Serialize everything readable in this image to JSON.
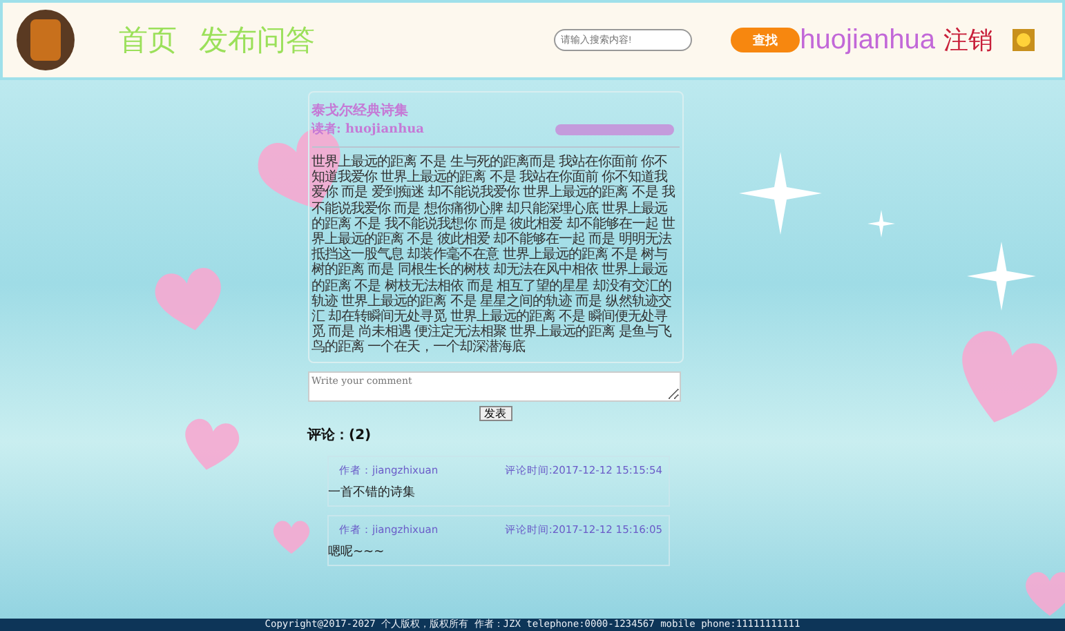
{
  "header": {
    "nav": [
      {
        "label": "首页"
      },
      {
        "label": "发布问答"
      }
    ],
    "search": {
      "placeholder": "请输入搜索内容!"
    },
    "search_button": "查找",
    "user": "huojianhua",
    "logout": "注销"
  },
  "article": {
    "title": "泰戈尔经典诗集",
    "reader": "读者: huojianhua",
    "body": "世界上最远的距离 不是 生与死的距离而是 我站在你面前 你不知道我爱你 世界上最远的距离 不是 我站在你面前 你不知道我爱你 而是 爱到痴迷 却不能说我爱你 世界上最远的距离 不是 我不能说我爱你 而是 想你痛彻心脾 却只能深埋心底 世界上最远的距离 不是 我不能说我想你 而是 彼此相爱 却不能够在一起 世界上最远的距离 不是 彼此相爱 却不能够在一起 而是 明明无法抵挡这一股气息 却装作毫不在意 世界上最远的距离 不是 树与树的距离 而是 同根生长的树枝 却无法在风中相依 世界上最远的距离 不是 树枝无法相依 而是 相互了望的星星 却没有交汇的轨迹 世界上最远的距离 不是 星星之间的轨迹 而是 纵然轨迹交汇 却在转瞬间无处寻觅 世界上最远的距离 不是 瞬间便无处寻觅 而是 尚未相遇 便注定无法相聚 世界上最远的距离 是鱼与飞鸟的距离 一个在天，一个却深潜海底"
  },
  "comment_form": {
    "placeholder": "Write your comment",
    "submit": "发表"
  },
  "comments_heading": "评论：(2)",
  "comments": [
    {
      "author": "作者：jiangzhixuan",
      "time": "评论时间:2017-12-12 15:15:54",
      "text": "一首不错的诗集"
    },
    {
      "author": "作者：jiangzhixuan",
      "time": "评论时间:2017-12-12 15:16:05",
      "text": "嗯呢~~~"
    }
  ],
  "footer": "Copyright@2017-2027 个人版权，版权所有 作者：JZX telephone:0000-1234567 mobile phone:11111111111"
}
